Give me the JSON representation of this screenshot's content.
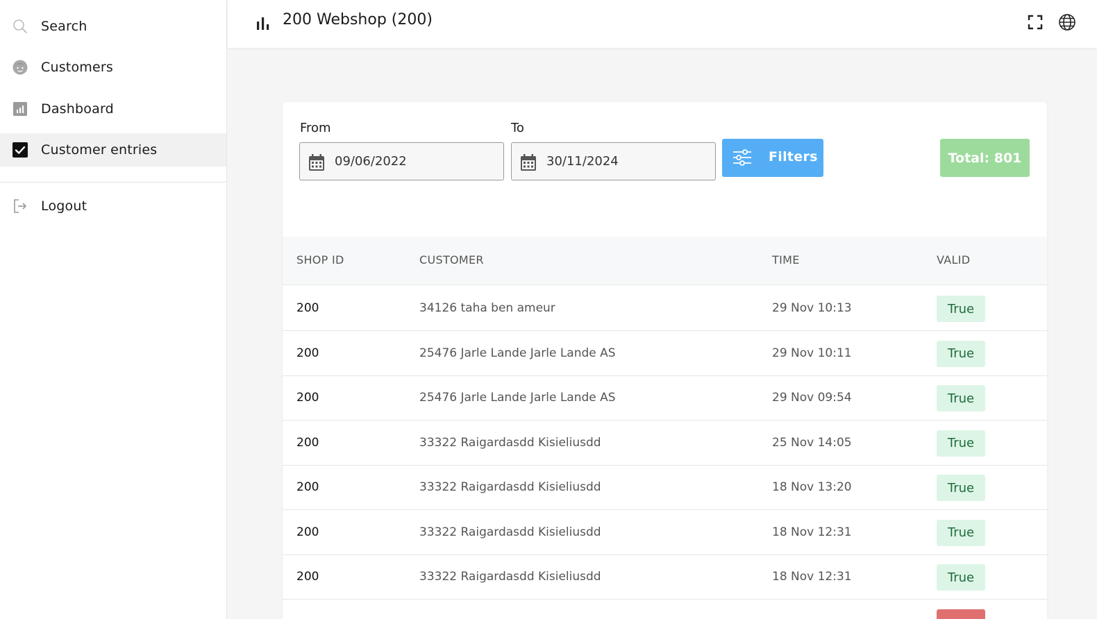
{
  "sidebar": {
    "items": [
      {
        "label": "Search",
        "icon": "search-icon"
      },
      {
        "label": "Customers",
        "icon": "customer-face-icon"
      },
      {
        "label": "Dashboard",
        "icon": "dashboard-icon"
      },
      {
        "label": "Customer entries",
        "icon": "checkbox-checked-icon",
        "active": true
      },
      {
        "label": "Logout",
        "icon": "logout-icon"
      }
    ]
  },
  "header": {
    "title": "200 Webshop (200)",
    "title_icon": "bar-chart-icon",
    "actions": [
      "fullscreen-icon",
      "globe-icon"
    ]
  },
  "filters": {
    "from_label": "From",
    "from_value": "09/06/2022",
    "to_label": "To",
    "to_value": "30/11/2024",
    "filters_button": "Filters",
    "total": "Total: 801"
  },
  "table": {
    "columns": [
      "SHOP ID",
      "CUSTOMER",
      "TIME",
      "VALID"
    ],
    "rows": [
      {
        "shop_id": "200",
        "customer": "34126 taha ben ameur",
        "time": "29 Nov 10:13",
        "valid": "True"
      },
      {
        "shop_id": "200",
        "customer": "25476 Jarle Lande Jarle Lande AS",
        "time": "29 Nov 10:11",
        "valid": "True"
      },
      {
        "shop_id": "200",
        "customer": "25476 Jarle Lande Jarle Lande AS",
        "time": "29 Nov 09:54",
        "valid": "True"
      },
      {
        "shop_id": "200",
        "customer": "33322 Raigardasdd Kisieliusdd",
        "time": "25 Nov 14:05",
        "valid": "True"
      },
      {
        "shop_id": "200",
        "customer": "33322 Raigardasdd Kisieliusdd",
        "time": "18 Nov 13:20",
        "valid": "True"
      },
      {
        "shop_id": "200",
        "customer": "33322 Raigardasdd Kisieliusdd",
        "time": "18 Nov 12:31",
        "valid": "True"
      },
      {
        "shop_id": "200",
        "customer": "33322 Raigardasdd Kisieliusdd",
        "time": "18 Nov 12:31",
        "valid": "True"
      }
    ]
  },
  "colors": {
    "accent": "#55aef5",
    "total": "#9ddb9d",
    "valid_true_bg": "#ddf5e6",
    "valid_false_bg": "#e07070"
  }
}
